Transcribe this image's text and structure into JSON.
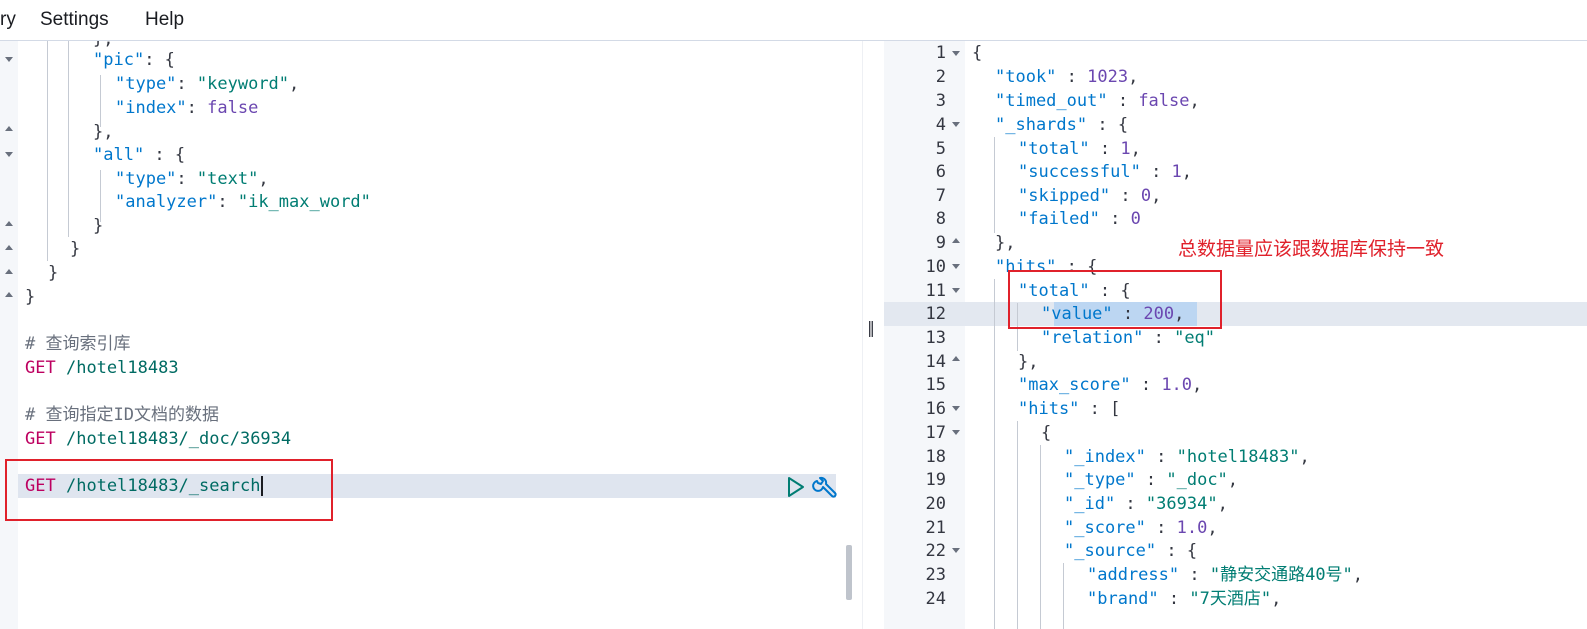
{
  "menu": {
    "item1": "ry",
    "item2": "Settings",
    "item3": "Help"
  },
  "request_editor": {
    "lines": [
      {
        "text": "},"
      },
      {
        "key": "\"pic\"",
        "rest": ": {"
      },
      {
        "key": "\"type\"",
        "mid": ": ",
        "str": "\"keyword\"",
        "end": ","
      },
      {
        "key": "\"index\"",
        "mid": ": ",
        "val": "false"
      },
      {
        "text": "},"
      },
      {
        "key": "\"all\"",
        "rest": " : {"
      },
      {
        "key": "\"type\"",
        "mid": ": ",
        "str": "\"text\"",
        "end": ","
      },
      {
        "key": "\"analyzer\"",
        "mid": ": ",
        "str": "\"ik_max_word\""
      },
      {
        "text": "}"
      },
      {
        "text": "}"
      },
      {
        "text": "}"
      },
      {
        "text": "}"
      }
    ],
    "comment1": "# 查询索引库",
    "req1_method": "GET",
    "req1_url": "/hotel18483",
    "comment2": "# 查询指定ID文档的数据",
    "req2_method": "GET",
    "req2_url": "/hotel18483/_doc/36934",
    "req3_method": "GET",
    "req3_url": "/hotel18483/_search"
  },
  "response_viewer": {
    "line_numbers": [
      "1",
      "2",
      "3",
      "4",
      "5",
      "6",
      "7",
      "8",
      "9",
      "10",
      "11",
      "12",
      "13",
      "14",
      "15",
      "16",
      "17",
      "18",
      "19",
      "20",
      "21",
      "22",
      "23",
      "24"
    ],
    "l1": "{",
    "took_key": "\"took\"",
    "took_val": "1023",
    "timed_out_key": "\"timed_out\"",
    "timed_out_val": "false",
    "shards_key": "\"_shards\"",
    "total_key": "\"total\"",
    "total_val": "1",
    "successful_key": "\"successful\"",
    "successful_val": "1",
    "skipped_key": "\"skipped\"",
    "skipped_val": "0",
    "failed_key": "\"failed\"",
    "failed_val": "0",
    "close_brace_comma": "},",
    "hits_key": "\"hits\"",
    "hits_total_key": "\"total\"",
    "value_key": "\"value\"",
    "value_val": "200",
    "relation_key": "\"relation\"",
    "relation_val": "\"eq\"",
    "max_score_key": "\"max_score\"",
    "max_score_val": "1.0",
    "inner_hits_key": "\"hits\"",
    "open_brace": "{",
    "index_key": "\"_index\"",
    "index_val": "\"hotel18483\"",
    "type_key": "\"_type\"",
    "type_val": "\"_doc\"",
    "id_key": "\"_id\"",
    "id_val": "\"36934\"",
    "score_key": "\"_score\"",
    "score_val": "1.0",
    "source_key": "\"_source\"",
    "address_key": "\"address\"",
    "address_val": "\"静安交通路40号\"",
    "brand_key": "\"brand\"",
    "brand_val": "\"7天酒店\""
  },
  "annotation": "总数据量应该跟数据库保持一致",
  "colors": {
    "annotation_red": "#e0212b",
    "key_blue": "#0077cc",
    "string_green": "#017d73",
    "method_magenta": "#bd0060"
  },
  "icons": [
    "play-icon",
    "wrench-icon",
    "fold-arrow-icon",
    "pane-resize-icon"
  ]
}
